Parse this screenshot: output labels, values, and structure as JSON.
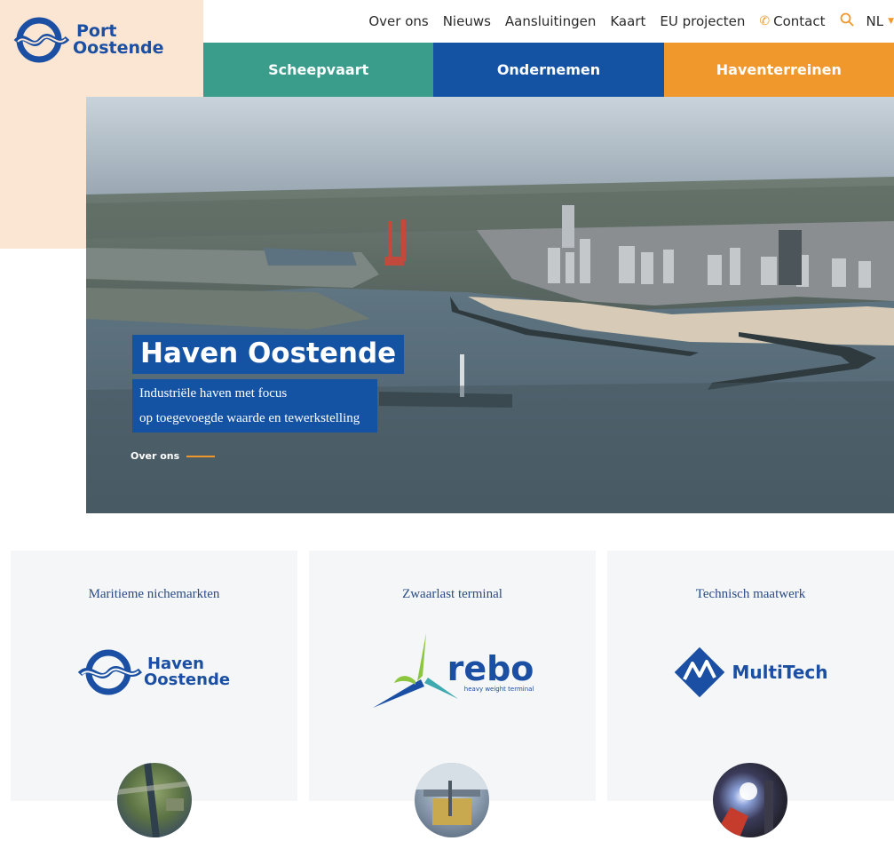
{
  "logo": {
    "line1": "Port",
    "line2": "Oostende"
  },
  "topnav": {
    "items": [
      "Over ons",
      "Nieuws",
      "Aansluitingen",
      "Kaart",
      "EU projecten"
    ],
    "contact": "Contact",
    "lang": "NL"
  },
  "tabs": [
    "Scheepvaart",
    "Ondernemen",
    "Haventerreinen"
  ],
  "hero": {
    "title": "Haven Oostende",
    "subtitle_line1": "Industriële haven met focus",
    "subtitle_line2": "op toegevoegde waarde en tewerkstelling",
    "link": "Over ons"
  },
  "cards": [
    {
      "title": "Maritieme nichemarkten",
      "logo_line1": "Haven",
      "logo_line2": "Oostende"
    },
    {
      "title": "Zwaarlast terminal",
      "logo_main": "rebo",
      "logo_tag": "heavy weight terminal"
    },
    {
      "title": "Technisch maatwerk",
      "logo_main": "MultiTech"
    }
  ],
  "colors": {
    "brand_blue": "#1452a4",
    "teal": "#3a9c8a",
    "orange": "#f0982c",
    "peach": "#fbe5d3",
    "card_bg": "#f4f6f7"
  },
  "icons": [
    "phone-icon",
    "search-icon",
    "caret-down-icon"
  ]
}
